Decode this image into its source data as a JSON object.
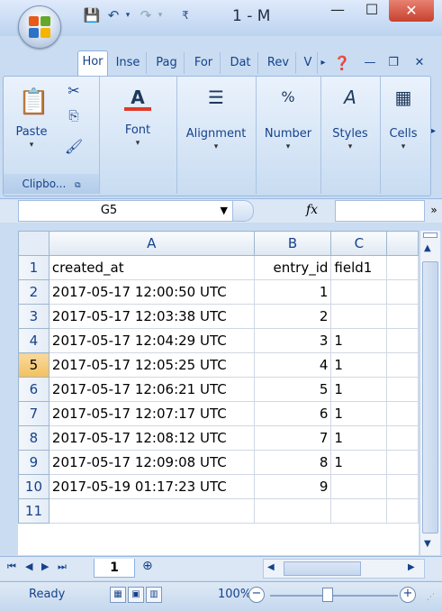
{
  "window": {
    "title": "1 - M",
    "min_glyph": "—",
    "max_glyph": "☐",
    "close_glyph": "✕"
  },
  "ribbon": {
    "tabs": [
      "Hor",
      "Inse",
      "Pag",
      "For",
      "Dat",
      "Rev",
      "V"
    ],
    "groups": {
      "paste": "Paste",
      "clipboard": "Clipbo...",
      "font": "Font",
      "alignment": "Alignment",
      "number": "Number",
      "styles": "Styles",
      "cells": "Cells"
    },
    "icons": {
      "font": "A",
      "number": "%",
      "styles": "A"
    }
  },
  "formula_bar": {
    "name_box": "G5",
    "fx": "fx",
    "formula": ""
  },
  "sheet": {
    "columns": [
      "A",
      "B",
      "C"
    ],
    "selected_row": 5,
    "rows": [
      {
        "n": "1",
        "a": "created_at",
        "b": "entry_id",
        "c": "field1"
      },
      {
        "n": "2",
        "a": "2017-05-17 12:00:50 UTC",
        "b": "1",
        "c": ""
      },
      {
        "n": "3",
        "a": "2017-05-17 12:03:38 UTC",
        "b": "2",
        "c": ""
      },
      {
        "n": "4",
        "a": "2017-05-17 12:04:29 UTC",
        "b": "3",
        "c": "1"
      },
      {
        "n": "5",
        "a": "2017-05-17 12:05:25 UTC",
        "b": "4",
        "c": "1"
      },
      {
        "n": "6",
        "a": "2017-05-17 12:06:21 UTC",
        "b": "5",
        "c": "1"
      },
      {
        "n": "7",
        "a": "2017-05-17 12:07:17 UTC",
        "b": "6",
        "c": "1"
      },
      {
        "n": "8",
        "a": "2017-05-17 12:08:12 UTC",
        "b": "7",
        "c": "1"
      },
      {
        "n": "9",
        "a": "2017-05-17 12:09:08 UTC",
        "b": "8",
        "c": "1"
      },
      {
        "n": "10",
        "a": "2017-05-19 01:17:23 UTC",
        "b": "9",
        "c": ""
      },
      {
        "n": "11",
        "a": "",
        "b": "",
        "c": ""
      }
    ],
    "tab_name": "1"
  },
  "status": {
    "ready": "Ready",
    "zoom": "100%"
  },
  "colors": {
    "accent": "#15428b",
    "selected_row": "#f1c15f"
  }
}
